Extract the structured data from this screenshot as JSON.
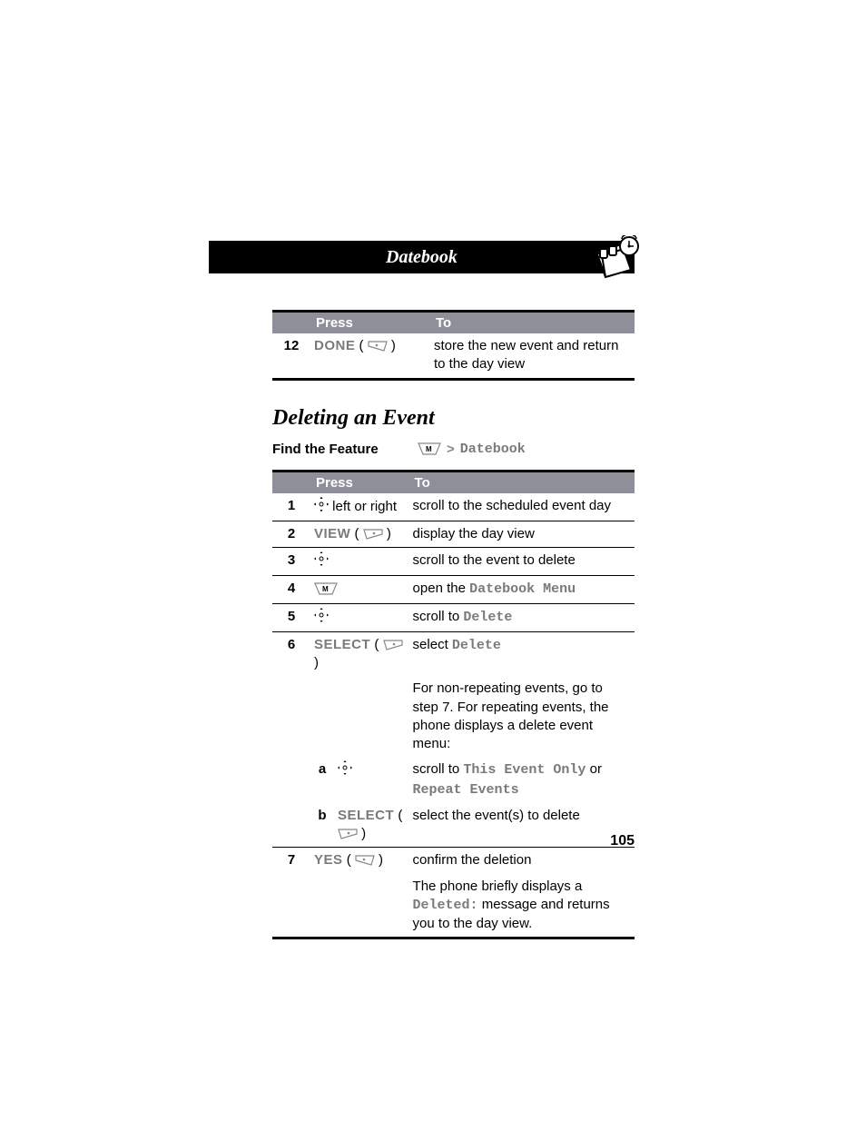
{
  "header": {
    "title": "Datebook"
  },
  "table1": {
    "headers": {
      "press": "Press",
      "to": "To"
    },
    "rows": [
      {
        "num": "12",
        "press": "DONE",
        "to": "store the new event and return to the day view"
      }
    ]
  },
  "section": {
    "heading": "Deleting an Event",
    "find_feature_label": "Find the Feature",
    "feature_path": "Datebook"
  },
  "table2": {
    "headers": {
      "press": "Press",
      "to": "To"
    },
    "rows": {
      "r1": {
        "num": "1",
        "press_suffix": " left or right",
        "to": "scroll to the scheduled event day"
      },
      "r2": {
        "num": "2",
        "press": "VIEW",
        "to": "display the day view"
      },
      "r3": {
        "num": "3",
        "to": "scroll to the event to delete"
      },
      "r4": {
        "num": "4",
        "to_prefix": "open the ",
        "to_mono": "Datebook Menu"
      },
      "r5": {
        "num": "5",
        "to_prefix": "scroll to ",
        "to_mono": "Delete"
      },
      "r6": {
        "num": "6",
        "press": "SELECT",
        "to_prefix": "select ",
        "to_mono": "Delete"
      },
      "r6note": {
        "to": "For non-repeating events, go to step 7. For repeating events, the phone displays a delete event menu:"
      },
      "r6a": {
        "sub": "a",
        "to_prefix": "scroll to ",
        "to_mono1": "This Event Only",
        "to_mid": " or ",
        "to_mono2": "Repeat Events"
      },
      "r6b": {
        "sub": "b",
        "press": "SELECT",
        "to": "select the event(s) to delete"
      },
      "r7": {
        "num": "7",
        "press": "YES",
        "to": "confirm the deletion"
      },
      "r7note": {
        "to_prefix": "The phone briefly displays a ",
        "to_mono": "Deleted:",
        "to_suffix": " message and returns you to the day view."
      }
    }
  },
  "page_number": "105"
}
